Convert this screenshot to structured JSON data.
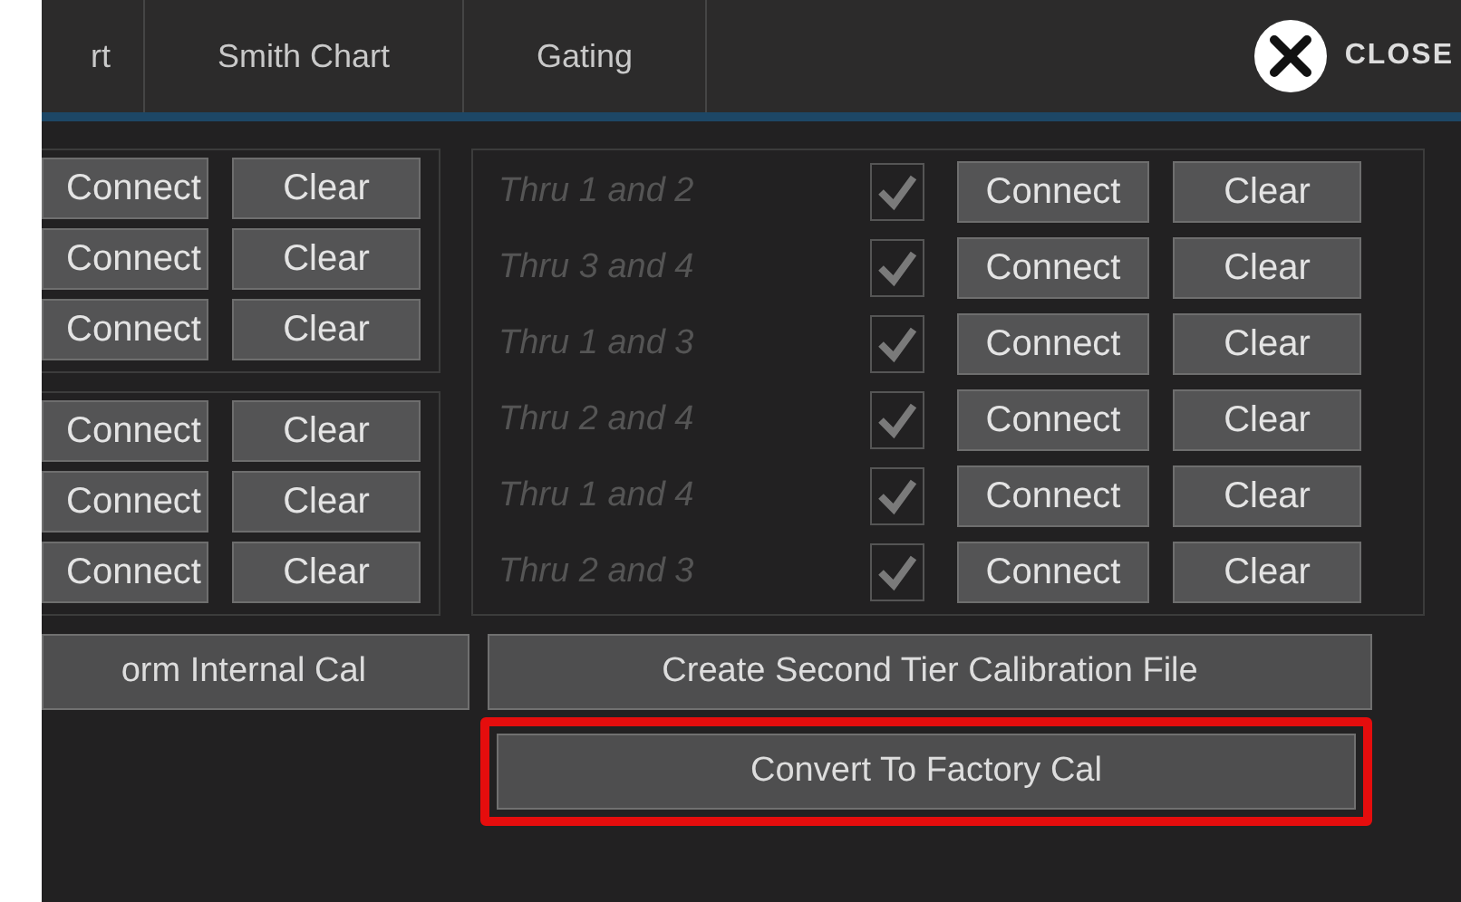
{
  "tabs": [
    {
      "label": "rt",
      "selected": false
    },
    {
      "label": "Smith Chart",
      "selected": false
    },
    {
      "label": "Gating",
      "selected": false
    }
  ],
  "close": {
    "label": "CLOSE"
  },
  "left_groups": [
    {
      "rows": [
        {
          "connect": "Connect",
          "clear": "Clear"
        },
        {
          "connect": "Connect",
          "clear": "Clear"
        },
        {
          "connect": "Connect",
          "clear": "Clear"
        }
      ]
    },
    {
      "rows": [
        {
          "connect": "Connect",
          "clear": "Clear"
        },
        {
          "connect": "Connect",
          "clear": "Clear"
        },
        {
          "connect": "Connect",
          "clear": "Clear"
        }
      ]
    }
  ],
  "thru_rows": [
    {
      "label": "Thru 1 and 2",
      "checked": true,
      "disabled": true,
      "connect": "Connect",
      "clear": "Clear"
    },
    {
      "label": "Thru 3 and 4",
      "checked": true,
      "disabled": true,
      "connect": "Connect",
      "clear": "Clear"
    },
    {
      "label": "Thru 1 and 3",
      "checked": true,
      "disabled": true,
      "connect": "Connect",
      "clear": "Clear"
    },
    {
      "label": "Thru 2 and 4",
      "checked": true,
      "disabled": true,
      "connect": "Connect",
      "clear": "Clear"
    },
    {
      "label": "Thru 1 and 4",
      "checked": true,
      "disabled": true,
      "connect": "Connect",
      "clear": "Clear"
    },
    {
      "label": "Thru 2 and 3",
      "checked": true,
      "disabled": true,
      "connect": "Connect",
      "clear": "Clear"
    }
  ],
  "actions": [
    {
      "label": "orm Internal Cal",
      "highlighted": false
    },
    {
      "label": "Create Second Tier Calibration File",
      "highlighted": false
    },
    {
      "label": "Convert To Factory Cal",
      "highlighted": true
    }
  ]
}
